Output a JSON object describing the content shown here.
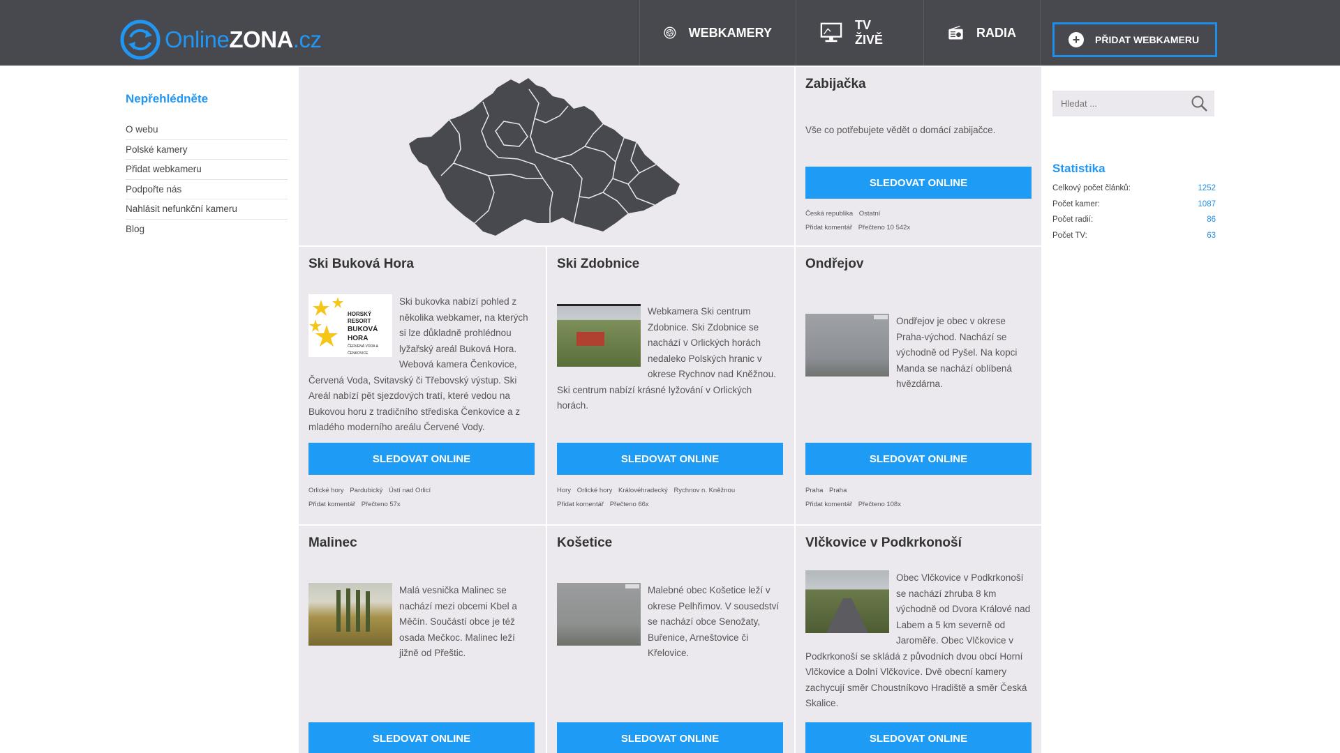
{
  "header": {
    "logo": {
      "part1": "Online",
      "part2": "ZONA",
      "part3": ".cz"
    },
    "nav": [
      {
        "label": "WEBKAMERY",
        "icon": "camera-aperture-icon"
      },
      {
        "label": "TV ŽIVĚ",
        "icon": "monitor-icon"
      },
      {
        "label": "RADIA",
        "icon": "radio-icon"
      }
    ],
    "add_button": "PŘIDAT WEBKAMERU"
  },
  "sidebar": {
    "title": "Nepřehlédněte",
    "items": [
      "O webu",
      "Polské kamery",
      "Přidat webkameru",
      "Podpořte nás",
      "Nahlásit nefunkční kameru",
      "Blog"
    ]
  },
  "featured": {
    "title": "Zabijačka",
    "text": "Vše co potřebujete vědět o domácí zabijačce.",
    "button": "SLEDOVAT ONLINE",
    "tags": [
      "Česká republika",
      "Ostatní"
    ],
    "comment": "Přidat komentář",
    "views": "Přečteno 10 542x"
  },
  "cards": [
    {
      "title": "Ski Buková Hora",
      "text": "Ski bukovka nabízí pohled z několika webkamer, na kterých si lze důkladně prohlédnou lyžařský areál Buková Hora. Webová kamera Čenkovice, Červená Voda, Svitavský či Třebovský výstup. Ski Areál nabízí pět sjezdových tratí, které vedou na Bukovou horu z tradičního střediska Čenkovice a z mladého moderního areálu Červené Vody.",
      "thumb_text": [
        "HORSKÝ RESORT",
        "BUKOVÁ HORA",
        "ČERVENÁ VODA & ČENKOVICE"
      ],
      "button": "SLEDOVAT ONLINE",
      "tags": [
        "Orlické hory",
        "Pardubický",
        "Ústí nad Orlicí"
      ],
      "comment": "Přidat komentář",
      "views": "Přečteno 57x"
    },
    {
      "title": "Ski Zdobnice",
      "text": "Webkamera Ski centrum Zdobnice. Ski Zdobnice se nachází v Orlických horách nedaleko Polských hranic v okrese Rychnov nad Kněžnou. Ski centrum nabízí krásné lyžování v Orlických horách.",
      "button": "SLEDOVAT ONLINE",
      "tags": [
        "Hory",
        "Orlické hory",
        "Královéhradecký",
        "Rychnov n. Kněžnou"
      ],
      "comment": "Přidat komentář",
      "views": "Přečteno 66x"
    },
    {
      "title": "Ondřejov",
      "text": "Ondřejov je obec v okrese Praha-východ. Nachází se východně od Pyšel. Na kopci Manda se nachází oblíbená hvězdárna.",
      "button": "SLEDOVAT ONLINE",
      "tags": [
        "Praha",
        "Praha"
      ],
      "comment": "Přidat komentář",
      "views": "Přečteno 108x"
    },
    {
      "title": "Malinec",
      "text": "Malá vesnička Malinec se nachází mezi obcemi Kbel a Měčín. Součástí obce je též osada Mečkoc. Malinec leží jižně od Přeštic.",
      "button": "SLEDOVAT ONLINE"
    },
    {
      "title": "Košetice",
      "text": "Malebné obec Košetice leží v okrese Pelhřimov. V sousedství se nachází obce Senožaty, Buřenice, Arneštovice či Křelovice.",
      "button": "SLEDOVAT ONLINE"
    },
    {
      "title": "Vlčkovice v Podkrkonoší",
      "text": "Obec Vlčkovice v Podkrkonoší se nachází zhruba 8 km východně od Dvora Králové nad Labem a 5 km severně od Jaroměře. Obec Vlčkovice v Podkrkonoší se skládá z původních dvou obcí Horní Vlčkovice a Dolní Vlčkovice. Dvě obecní kamery zachycují směr Choustníkovo Hradiště a směr Česká Skalice.",
      "button": "SLEDOVAT ONLINE"
    }
  ],
  "search": {
    "placeholder": "Hledat ..."
  },
  "stats": {
    "title": "Statistika",
    "rows": [
      {
        "label": "Celkový počet článků:",
        "value": "1252"
      },
      {
        "label": "Počet kamer:",
        "value": "1087"
      },
      {
        "label": "Počet radií:",
        "value": "86"
      },
      {
        "label": "Počet TV:",
        "value": "63"
      }
    ]
  },
  "colors": {
    "accent": "#1e9cf5",
    "header_bg": "#48484f",
    "card_bg": "#ebe9ee"
  }
}
